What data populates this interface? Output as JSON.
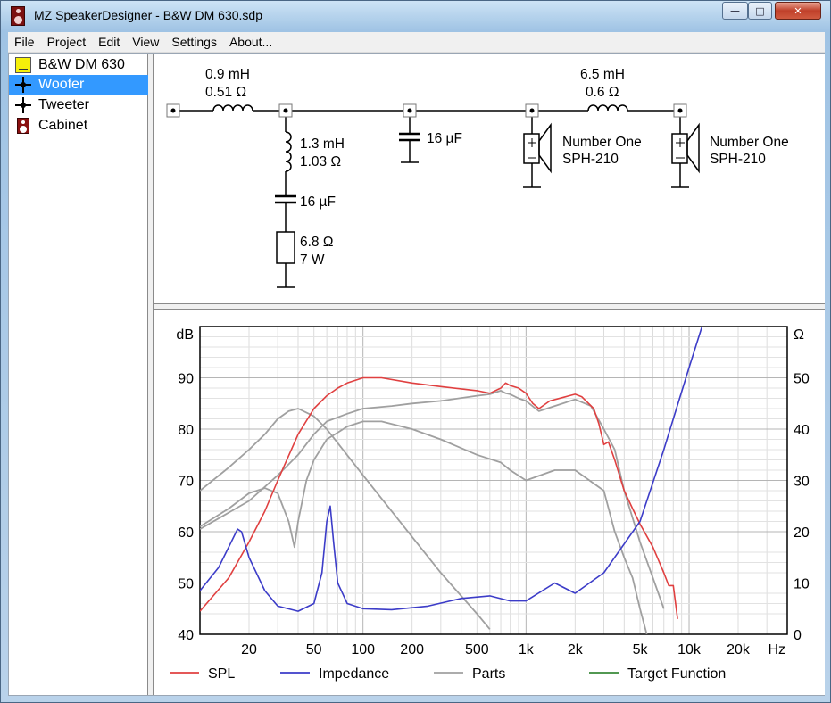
{
  "window": {
    "title": "MZ SpeakerDesigner - B&W DM 630.sdp"
  },
  "menu": [
    "File",
    "Project",
    "Edit",
    "View",
    "Settings",
    "About..."
  ],
  "tree": [
    {
      "label": "B&W DM 630",
      "icon": "project-icon"
    },
    {
      "label": "Woofer",
      "icon": "driver-icon",
      "selected": true
    },
    {
      "label": "Tweeter",
      "icon": "driver-icon"
    },
    {
      "label": "Cabinet",
      "icon": "cabinet-icon"
    }
  ],
  "schematic": {
    "l1": [
      "0.9 mH",
      "0.51 Ω"
    ],
    "l2": [
      "1.3 mH",
      "1.03 Ω"
    ],
    "c1": "16 µF",
    "c2": "16 µF",
    "r1": [
      "6.8 Ω",
      "7 W"
    ],
    "l3": [
      "6.5 mH",
      "0.6 Ω"
    ],
    "driver1": [
      "Number One",
      "SPH-210"
    ],
    "driver2": [
      "Number One",
      "SPH-210"
    ]
  },
  "chart_data": {
    "type": "line",
    "xscale": "log",
    "xlim": [
      10,
      40000
    ],
    "xticks": [
      20,
      50,
      100,
      200,
      500,
      1000,
      2000,
      5000,
      10000,
      20000
    ],
    "xtick_labels": [
      "20",
      "50",
      "100",
      "200",
      "500",
      "1k",
      "2k",
      "5k",
      "10k",
      "20k"
    ],
    "xunit": "Hz",
    "ylabel": "dB",
    "ylim": [
      40,
      100
    ],
    "yticks": [
      40,
      50,
      60,
      70,
      80,
      90
    ],
    "y2label": "Ω",
    "y2lim": [
      0,
      60
    ],
    "y2ticks": [
      0,
      10,
      20,
      30,
      40,
      50
    ],
    "grid": true,
    "legend_position": "bottom",
    "series": [
      {
        "name": "SPL",
        "color": "#e04040",
        "axis": "left",
        "x": [
          10,
          15,
          20,
          25,
          30,
          40,
          50,
          60,
          70,
          80,
          100,
          130,
          200,
          300,
          500,
          600,
          700,
          750,
          800,
          900,
          1000,
          1100,
          1200,
          1400,
          1700,
          2000,
          2200,
          2600,
          2800,
          3000,
          3200,
          3500,
          4000,
          4500,
          5000,
          6000,
          7000,
          7500,
          8000,
          8500
        ],
        "y": [
          44.5,
          51,
          58,
          64,
          70,
          79,
          84,
          86.5,
          88,
          89,
          90,
          90,
          89,
          88.3,
          87.5,
          87,
          88,
          89,
          88.5,
          88,
          87,
          85,
          84,
          85.5,
          86.2,
          86.8,
          86.3,
          84,
          81,
          77,
          77.5,
          74,
          68,
          64.5,
          61.5,
          57,
          52,
          49.5,
          49.5,
          43
        ]
      },
      {
        "name": "Impedance",
        "color": "#3c3cc8",
        "axis": "right",
        "x": [
          10,
          13,
          15,
          17,
          18,
          20,
          25,
          30,
          40,
          50,
          56,
          60,
          63,
          66,
          70,
          80,
          100,
          150,
          250,
          400,
          600,
          800,
          1000,
          1500,
          2000,
          3000,
          5000,
          7000,
          10000,
          12000
        ],
        "y": [
          8.5,
          13,
          17,
          20.5,
          20,
          15,
          8.5,
          5.5,
          4.5,
          6,
          12,
          22,
          25,
          18,
          10,
          6,
          5,
          4.8,
          5.5,
          7,
          7.5,
          6.5,
          6.5,
          10,
          8,
          12,
          22,
          36,
          52,
          60
        ]
      },
      {
        "name": "Parts",
        "color": "#a0a0a0",
        "axis": "left",
        "x": [
          10,
          15,
          20,
          25,
          30,
          35,
          40,
          50,
          60,
          100,
          200,
          300,
          500,
          600
        ],
        "y": [
          68,
          72.5,
          76,
          79,
          82,
          83.5,
          84,
          82.5,
          80,
          71,
          59,
          52,
          44,
          41
        ]
      },
      {
        "name": "Parts",
        "color": "#a0a0a0",
        "axis": "left",
        "x": [
          10,
          15,
          20,
          25,
          30,
          35,
          38,
          40,
          45,
          50,
          60,
          80,
          100,
          130,
          200,
          300,
          500,
          700,
          800,
          1000,
          1500,
          2000,
          3000,
          3500,
          4000,
          4500,
          5000,
          5500
        ],
        "y": [
          61,
          64.5,
          67.5,
          68.5,
          67.5,
          62,
          57,
          62,
          70,
          74,
          78,
          80.5,
          81.5,
          81.5,
          80,
          78,
          75,
          73.5,
          72,
          70,
          72,
          72,
          68,
          60,
          55,
          51,
          45,
          40
        ]
      },
      {
        "name": "Parts",
        "color": "#a0a0a0",
        "axis": "left",
        "x": [
          10,
          20,
          30,
          40,
          50,
          60,
          80,
          100,
          150,
          200,
          300,
          500,
          600,
          700,
          750,
          800,
          900,
          1000,
          1200,
          1500,
          2000,
          2500,
          3000,
          3500,
          4000,
          5000,
          6000,
          7000
        ],
        "y": [
          60.5,
          66,
          71,
          75,
          79,
          81.5,
          83,
          84,
          84.5,
          85,
          85.5,
          86.5,
          86.8,
          87.5,
          87,
          86.8,
          86,
          85.5,
          83.5,
          84.5,
          85.8,
          84.5,
          80,
          76,
          68,
          58,
          51,
          45
        ]
      }
    ],
    "legend": [
      {
        "name": "SPL",
        "color": "#e04040"
      },
      {
        "name": "Impedance",
        "color": "#3c3cc8"
      },
      {
        "name": "Parts",
        "color": "#a0a0a0"
      },
      {
        "name": "Target Function",
        "color": "#3a8a3a"
      }
    ]
  }
}
